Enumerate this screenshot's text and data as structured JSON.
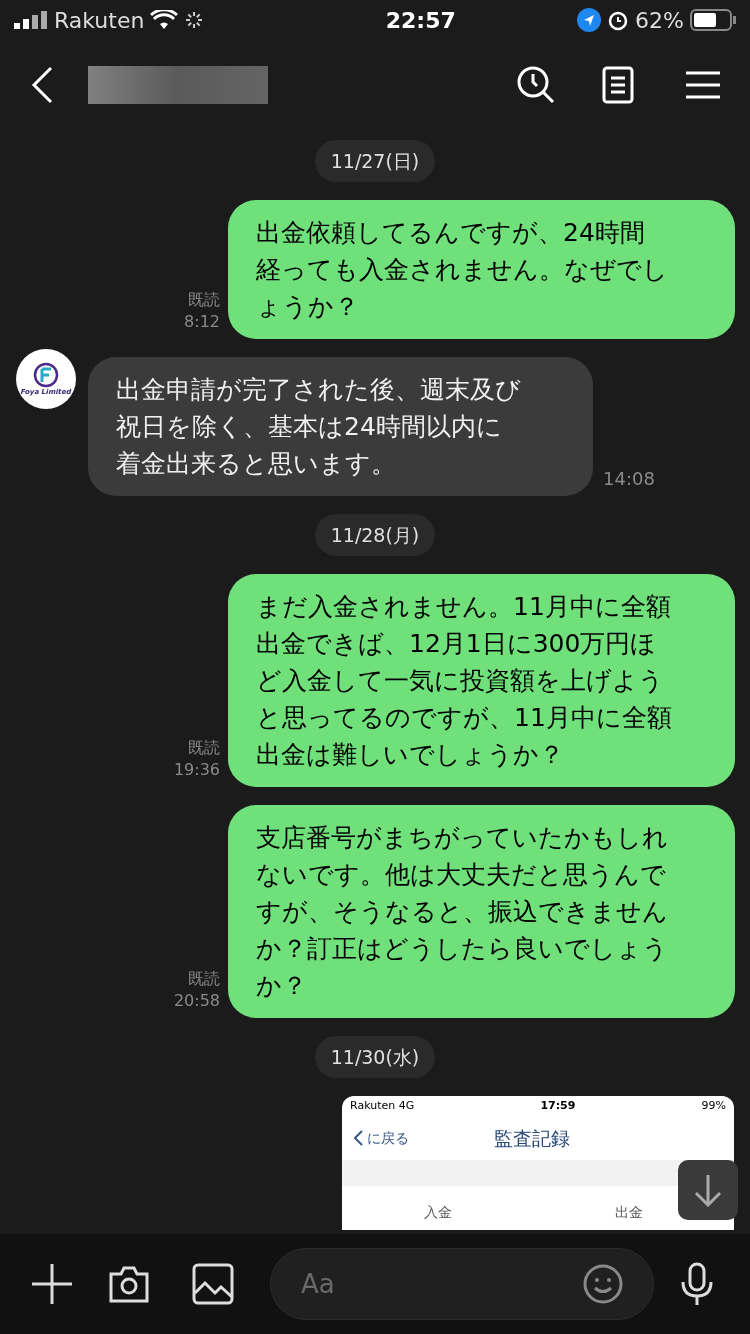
{
  "status_bar": {
    "carrier": "Rakuten",
    "time": "22:57",
    "battery": "62%"
  },
  "header": {
    "contact_name_blurred": true
  },
  "messages": [
    {
      "kind": "date",
      "text": "11/27(日)"
    },
    {
      "kind": "sent",
      "lines": [
        "出金依頼してるんですが、24時間",
        "経っても入金されません。なぜでし",
        "ょうか？"
      ],
      "read": "既読",
      "time": "8:12"
    },
    {
      "kind": "received",
      "sender_logo": "Foya Limited",
      "lines": [
        "出金申請が完了された後、週末及び",
        "祝日を除く、基本は24時間以内に",
        "着金出来ると思います。"
      ],
      "time": "14:08"
    },
    {
      "kind": "date",
      "text": "11/28(月)"
    },
    {
      "kind": "sent",
      "lines": [
        "まだ入金されません。11月中に全額",
        "出金できば、12月1日に300万円ほ",
        "ど入金して一気に投資額を上げよう",
        "と思ってるのですが、11月中に全額",
        "出金は難しいでしょうか？"
      ],
      "read": "既読",
      "time": "19:36"
    },
    {
      "kind": "sent",
      "lines": [
        "支店番号がまちがっていたかもしれ",
        "ないです。他は大丈夫だと思うんで",
        "すが、そうなると、振込できません",
        "か？訂正はどうしたら良いでしょう",
        "か？"
      ],
      "read": "既読",
      "time": "20:58"
    },
    {
      "kind": "date",
      "text": "11/30(水)"
    },
    {
      "kind": "image",
      "status": {
        "carrier": "Rakuten",
        "network": "4G",
        "time": "17:59",
        "battery": "99%"
      },
      "back": "に戻る",
      "title": "監査記録",
      "tabs": [
        "入金",
        "出金"
      ]
    }
  ],
  "input": {
    "placeholder": "Aa"
  }
}
